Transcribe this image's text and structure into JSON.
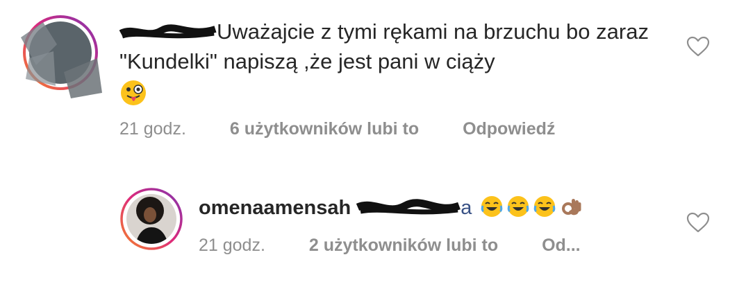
{
  "comment1": {
    "text": "Uważajcie z tymi rękami na brzuchu bo zaraz \"Kundelki\" napiszą ,że jest pani w ciąży",
    "time": "21 godz.",
    "likes": "6 użytkowników lubi to",
    "reply_label": "Odpowiedź",
    "emoji": "winking-tongue-emoji"
  },
  "comment2": {
    "username": "omenaamensah",
    "mention_suffix": "a",
    "time": "21 godz.",
    "likes": "2 użytkowników lubi to",
    "reply_label": "Od...",
    "emojis": [
      "joy-emoji",
      "joy-emoji",
      "joy-emoji",
      "ok-hand-emoji"
    ]
  },
  "colors": {
    "text": "#262626",
    "meta": "#8e8e8e",
    "mention": "#385185",
    "story_ring_start": "#f58529",
    "story_ring_end": "#8134af"
  }
}
